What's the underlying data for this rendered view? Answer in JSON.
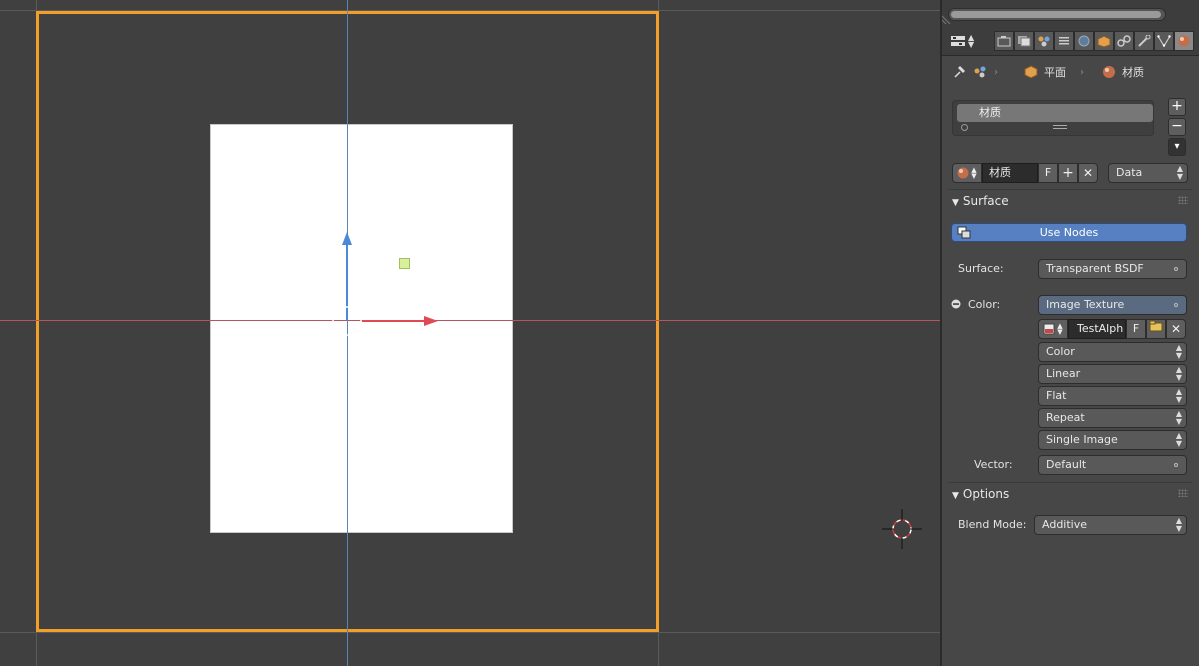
{
  "viewport": {
    "name": "3D Viewport"
  },
  "properties": {
    "breadcrumb": {
      "object": "平面",
      "material": "材质"
    },
    "material_slots": [
      {
        "name": "材质"
      }
    ],
    "material_id": {
      "name": "材质",
      "fake_user": "F",
      "link": "Data"
    },
    "surface_panel": {
      "title": "Surface",
      "use_nodes_label": "Use Nodes",
      "surface_label": "Surface:",
      "surface_value": "Transparent BSDF",
      "color_label": "Color:",
      "color_value": "Image Texture",
      "image_name": "TestAlph",
      "image_fake_user": "F",
      "color_space": "Color",
      "interpolation": "Linear",
      "projection": "Flat",
      "extension": "Repeat",
      "source": "Single Image",
      "vector_label": "Vector:",
      "vector_value": "Default"
    },
    "options_panel": {
      "title": "Options",
      "blend_mode_label": "Blend Mode:",
      "blend_mode_value": "Additive"
    },
    "context_tabs": [
      "render-icon",
      "render-layers-icon",
      "scene-icon",
      "world-icon",
      "object-icon",
      "constraints-icon",
      "modifiers-icon",
      "data-icon",
      "material-icon"
    ],
    "colors": {
      "camera_frame": "#f29f2a",
      "use_nodes_active": "#5680c2",
      "x_axis": "#b65560",
      "y_axis": "#5a86b4"
    }
  }
}
